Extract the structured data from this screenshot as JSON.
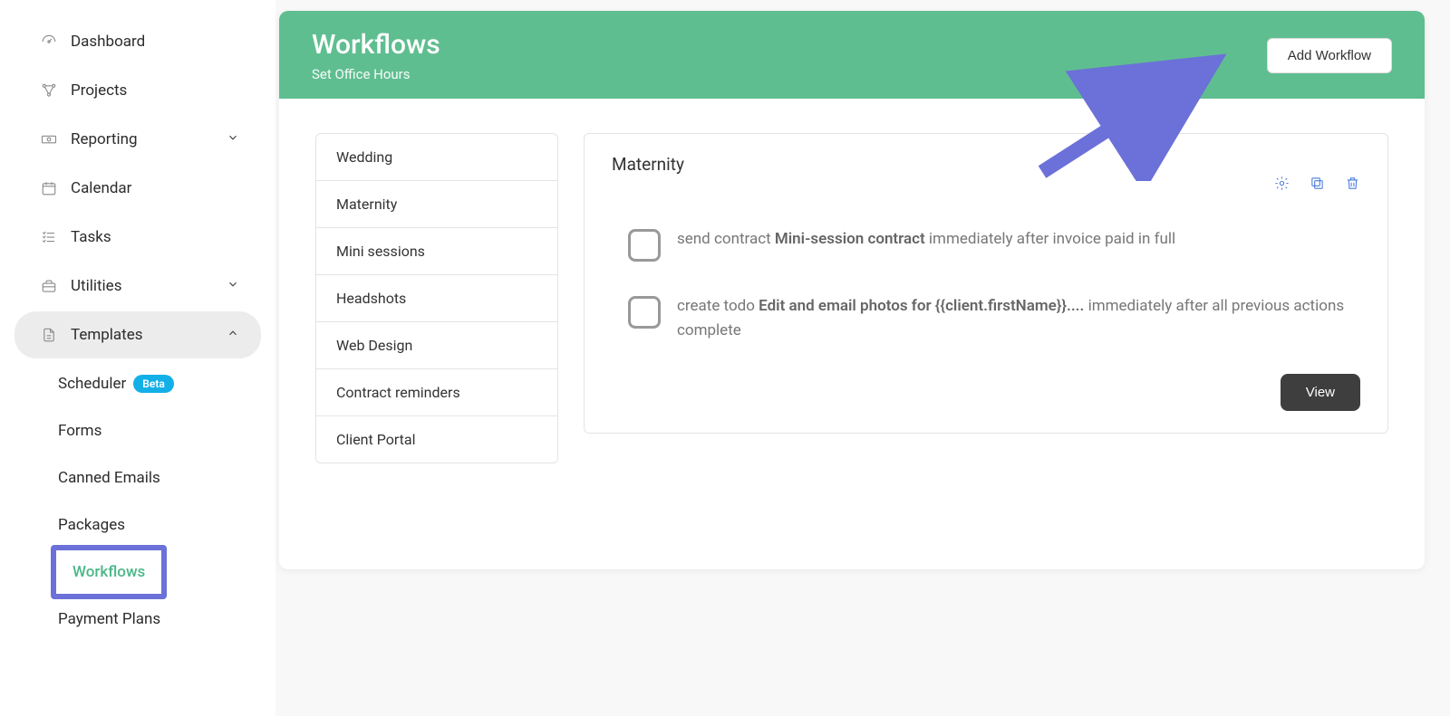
{
  "sidebar": {
    "items": [
      {
        "label": "Dashboard",
        "icon": "gauge-icon"
      },
      {
        "label": "Projects",
        "icon": "workflow-icon"
      },
      {
        "label": "Reporting",
        "icon": "cash-icon",
        "chevron": "down"
      },
      {
        "label": "Calendar",
        "icon": "calendar-icon"
      },
      {
        "label": "Tasks",
        "icon": "list-icon"
      },
      {
        "label": "Utilities",
        "icon": "toolbox-icon",
        "chevron": "down"
      },
      {
        "label": "Templates",
        "icon": "file-icon",
        "chevron": "up",
        "expanded": true
      }
    ],
    "templates_sub": [
      {
        "label": "Scheduler",
        "badge": "Beta"
      },
      {
        "label": "Forms"
      },
      {
        "label": "Canned Emails"
      },
      {
        "label": "Packages"
      },
      {
        "label": "Workflows",
        "active": true
      },
      {
        "label": "Payment Plans"
      }
    ]
  },
  "header": {
    "title": "Workflows",
    "subtitle": "Set Office Hours",
    "add_label": "Add Workflow"
  },
  "workflow_list": [
    "Wedding",
    "Maternity",
    "Mini sessions",
    "Headshots",
    "Web Design",
    "Contract reminders",
    "Client Portal"
  ],
  "detail": {
    "title": "Maternity",
    "steps": [
      {
        "prefix": "send contract ",
        "bold": "Mini-session contract",
        "suffix": " immediately after invoice paid in full"
      },
      {
        "prefix": "create todo ",
        "bold": "Edit and email photos for {{client.firstName}}....",
        "suffix": " immediately after all previous actions complete"
      }
    ],
    "view_label": "View"
  }
}
